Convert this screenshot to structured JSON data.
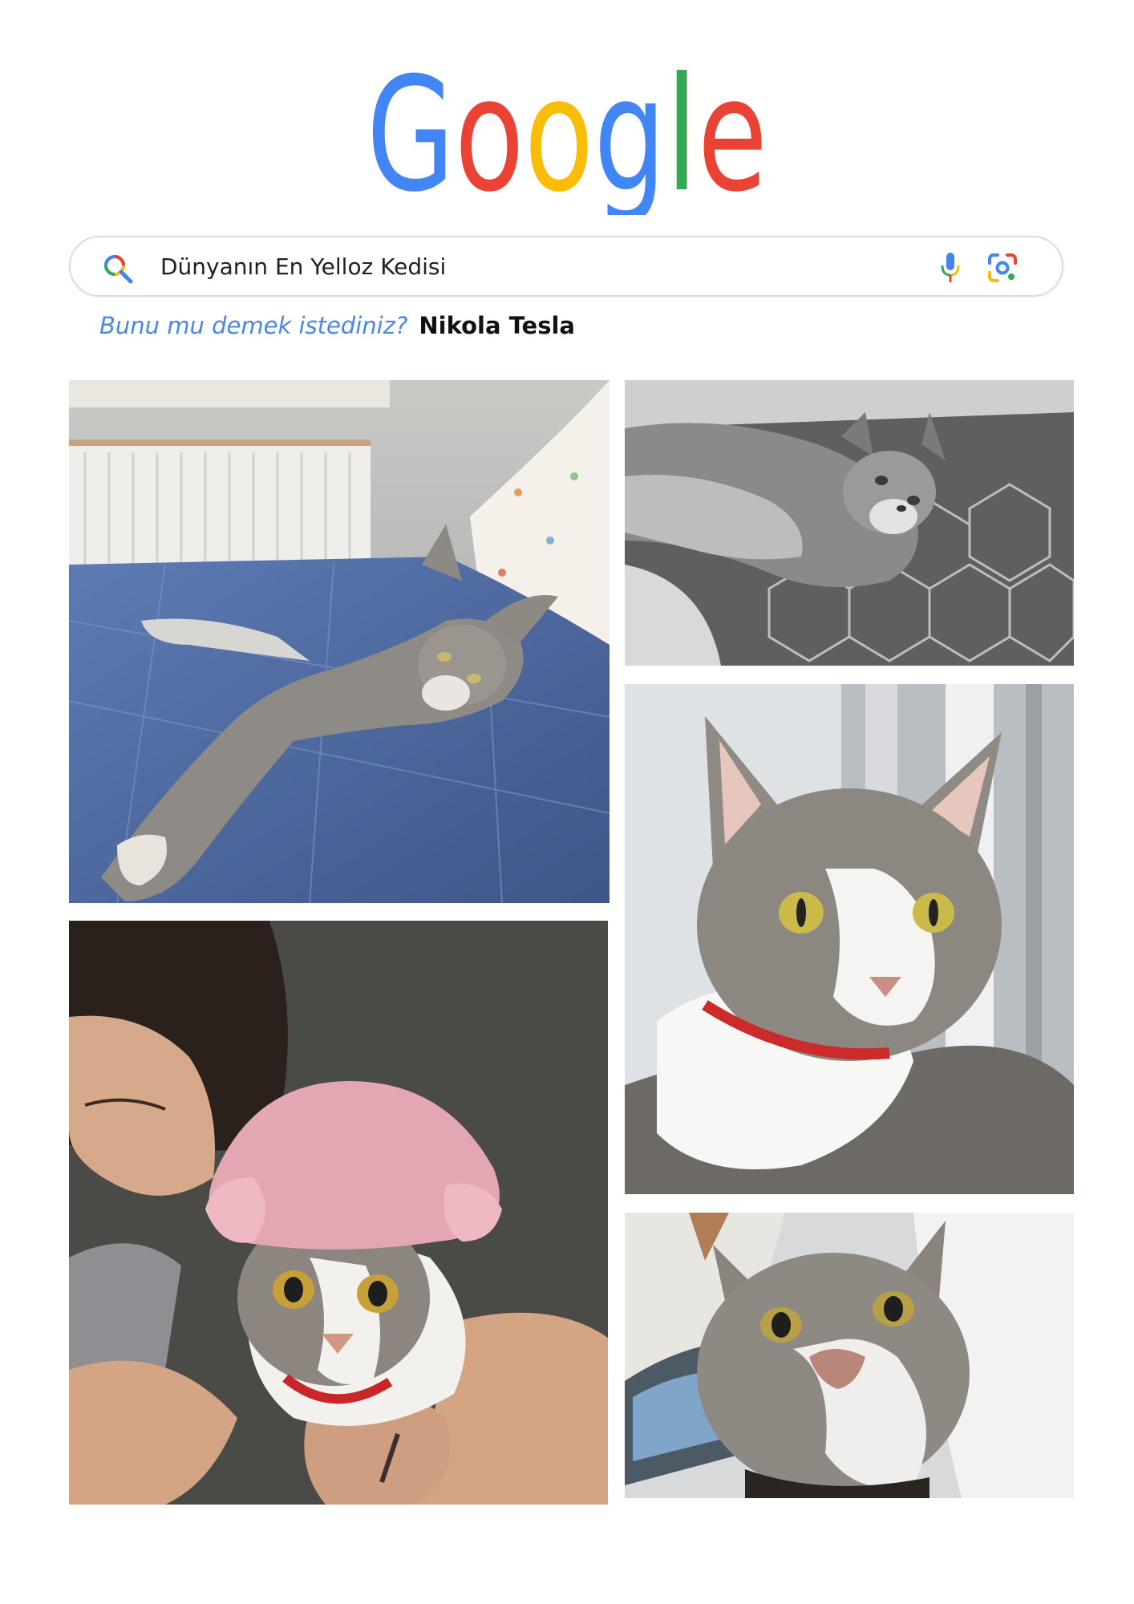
{
  "logo": {
    "letters": [
      "G",
      "o",
      "o",
      "g",
      "l",
      "e"
    ],
    "colors": [
      "#4285F4",
      "#EA4335",
      "#FBBC05",
      "#4285F4",
      "#34A853",
      "#EA4335"
    ]
  },
  "search": {
    "query": "Dünyanın En Yelloz Kedisi",
    "icons": [
      "search-icon",
      "microphone-icon",
      "lens-camera-icon"
    ]
  },
  "suggestion": {
    "prompt": "Bunu mu demek istediniz?",
    "answer": "Nikola Tesla"
  },
  "photos": [
    {
      "subject": "cat-stretched-on-blue-bed"
    },
    {
      "subject": "cat-lying-on-gray-patterned-blanket"
    },
    {
      "subject": "cat-portrait-with-red-collar"
    },
    {
      "subject": "cat-in-pink-knit-hat-held-by-person"
    },
    {
      "subject": "cat-closeup-looking-down"
    }
  ]
}
